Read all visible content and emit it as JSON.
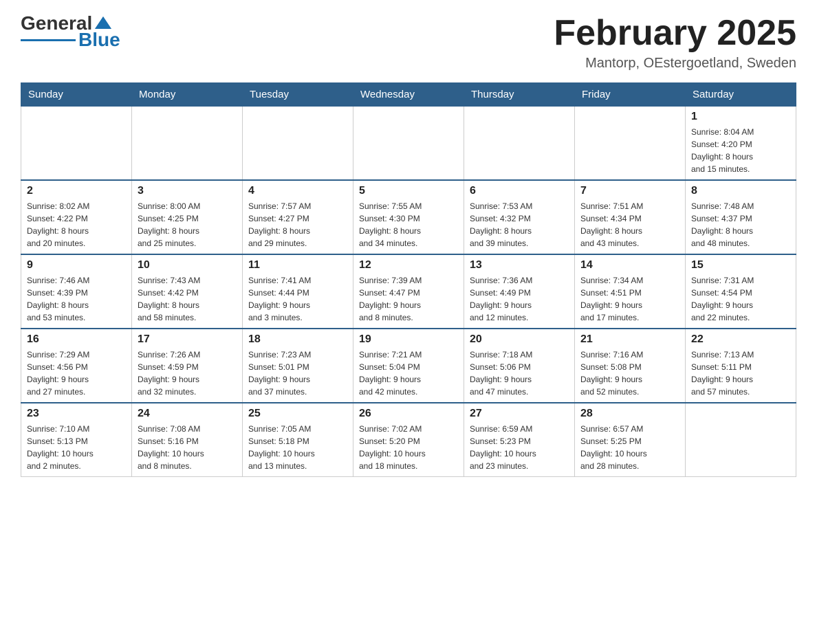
{
  "header": {
    "logo_general": "General",
    "logo_blue": "Blue",
    "title": "February 2025",
    "subtitle": "Mantorp, OEstergoetland, Sweden"
  },
  "days_of_week": [
    "Sunday",
    "Monday",
    "Tuesday",
    "Wednesday",
    "Thursday",
    "Friday",
    "Saturday"
  ],
  "weeks": [
    {
      "days": [
        {
          "num": "",
          "info": ""
        },
        {
          "num": "",
          "info": ""
        },
        {
          "num": "",
          "info": ""
        },
        {
          "num": "",
          "info": ""
        },
        {
          "num": "",
          "info": ""
        },
        {
          "num": "",
          "info": ""
        },
        {
          "num": "1",
          "info": "Sunrise: 8:04 AM\nSunset: 4:20 PM\nDaylight: 8 hours\nand 15 minutes."
        }
      ]
    },
    {
      "days": [
        {
          "num": "2",
          "info": "Sunrise: 8:02 AM\nSunset: 4:22 PM\nDaylight: 8 hours\nand 20 minutes."
        },
        {
          "num": "3",
          "info": "Sunrise: 8:00 AM\nSunset: 4:25 PM\nDaylight: 8 hours\nand 25 minutes."
        },
        {
          "num": "4",
          "info": "Sunrise: 7:57 AM\nSunset: 4:27 PM\nDaylight: 8 hours\nand 29 minutes."
        },
        {
          "num": "5",
          "info": "Sunrise: 7:55 AM\nSunset: 4:30 PM\nDaylight: 8 hours\nand 34 minutes."
        },
        {
          "num": "6",
          "info": "Sunrise: 7:53 AM\nSunset: 4:32 PM\nDaylight: 8 hours\nand 39 minutes."
        },
        {
          "num": "7",
          "info": "Sunrise: 7:51 AM\nSunset: 4:34 PM\nDaylight: 8 hours\nand 43 minutes."
        },
        {
          "num": "8",
          "info": "Sunrise: 7:48 AM\nSunset: 4:37 PM\nDaylight: 8 hours\nand 48 minutes."
        }
      ]
    },
    {
      "days": [
        {
          "num": "9",
          "info": "Sunrise: 7:46 AM\nSunset: 4:39 PM\nDaylight: 8 hours\nand 53 minutes."
        },
        {
          "num": "10",
          "info": "Sunrise: 7:43 AM\nSunset: 4:42 PM\nDaylight: 8 hours\nand 58 minutes."
        },
        {
          "num": "11",
          "info": "Sunrise: 7:41 AM\nSunset: 4:44 PM\nDaylight: 9 hours\nand 3 minutes."
        },
        {
          "num": "12",
          "info": "Sunrise: 7:39 AM\nSunset: 4:47 PM\nDaylight: 9 hours\nand 8 minutes."
        },
        {
          "num": "13",
          "info": "Sunrise: 7:36 AM\nSunset: 4:49 PM\nDaylight: 9 hours\nand 12 minutes."
        },
        {
          "num": "14",
          "info": "Sunrise: 7:34 AM\nSunset: 4:51 PM\nDaylight: 9 hours\nand 17 minutes."
        },
        {
          "num": "15",
          "info": "Sunrise: 7:31 AM\nSunset: 4:54 PM\nDaylight: 9 hours\nand 22 minutes."
        }
      ]
    },
    {
      "days": [
        {
          "num": "16",
          "info": "Sunrise: 7:29 AM\nSunset: 4:56 PM\nDaylight: 9 hours\nand 27 minutes."
        },
        {
          "num": "17",
          "info": "Sunrise: 7:26 AM\nSunset: 4:59 PM\nDaylight: 9 hours\nand 32 minutes."
        },
        {
          "num": "18",
          "info": "Sunrise: 7:23 AM\nSunset: 5:01 PM\nDaylight: 9 hours\nand 37 minutes."
        },
        {
          "num": "19",
          "info": "Sunrise: 7:21 AM\nSunset: 5:04 PM\nDaylight: 9 hours\nand 42 minutes."
        },
        {
          "num": "20",
          "info": "Sunrise: 7:18 AM\nSunset: 5:06 PM\nDaylight: 9 hours\nand 47 minutes."
        },
        {
          "num": "21",
          "info": "Sunrise: 7:16 AM\nSunset: 5:08 PM\nDaylight: 9 hours\nand 52 minutes."
        },
        {
          "num": "22",
          "info": "Sunrise: 7:13 AM\nSunset: 5:11 PM\nDaylight: 9 hours\nand 57 minutes."
        }
      ]
    },
    {
      "days": [
        {
          "num": "23",
          "info": "Sunrise: 7:10 AM\nSunset: 5:13 PM\nDaylight: 10 hours\nand 2 minutes."
        },
        {
          "num": "24",
          "info": "Sunrise: 7:08 AM\nSunset: 5:16 PM\nDaylight: 10 hours\nand 8 minutes."
        },
        {
          "num": "25",
          "info": "Sunrise: 7:05 AM\nSunset: 5:18 PM\nDaylight: 10 hours\nand 13 minutes."
        },
        {
          "num": "26",
          "info": "Sunrise: 7:02 AM\nSunset: 5:20 PM\nDaylight: 10 hours\nand 18 minutes."
        },
        {
          "num": "27",
          "info": "Sunrise: 6:59 AM\nSunset: 5:23 PM\nDaylight: 10 hours\nand 23 minutes."
        },
        {
          "num": "28",
          "info": "Sunrise: 6:57 AM\nSunset: 5:25 PM\nDaylight: 10 hours\nand 28 minutes."
        },
        {
          "num": "",
          "info": ""
        }
      ]
    }
  ]
}
